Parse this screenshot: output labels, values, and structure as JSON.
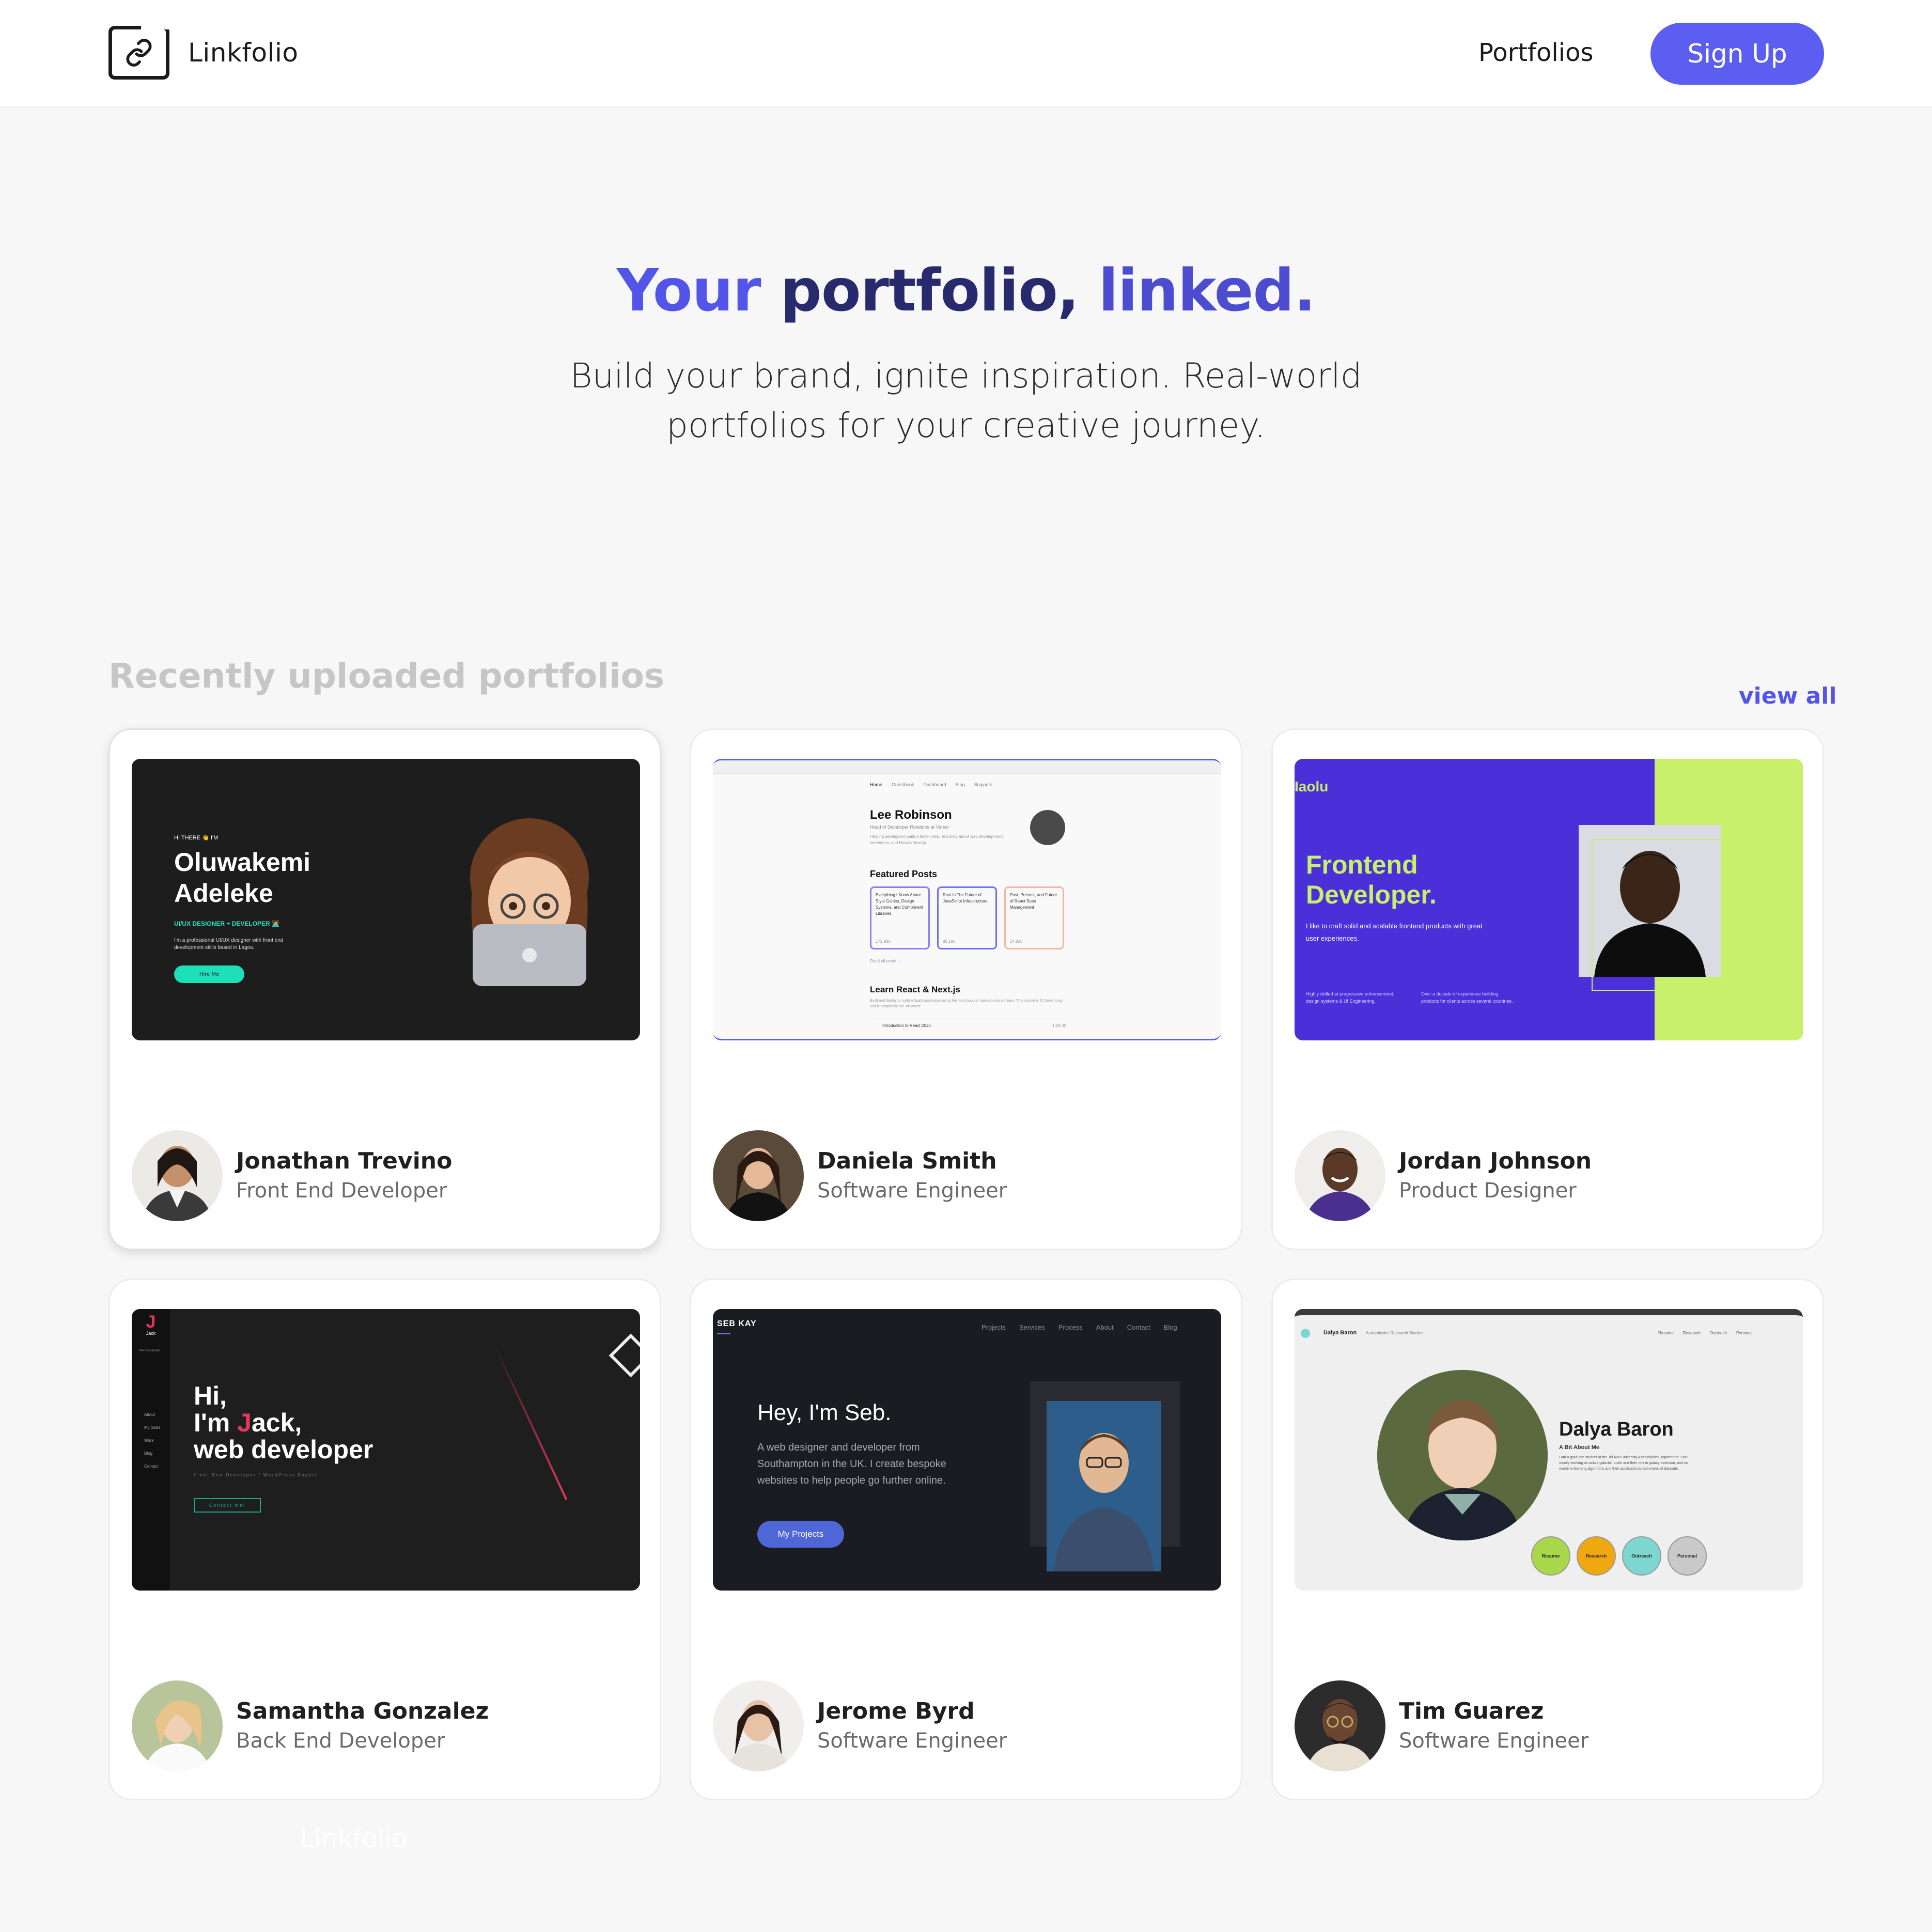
{
  "header": {
    "brand": "Linkfolio",
    "nav_portfolios": "Portfolios",
    "signup": "Sign Up"
  },
  "hero": {
    "title_w1": "Your",
    "title_w2": "portfolio,",
    "title_w3": "linked.",
    "subtitle": "Build your brand, ignite inspiration. Real-world portfolios for your creative journey."
  },
  "section": {
    "title": "Recently uploaded portfolios",
    "view_all": "view all"
  },
  "cards": [
    {
      "name": "Jonathan Trevino",
      "role": "Front End Developer",
      "thumb": {
        "greeting": "HI THERE 👋 I'M",
        "first": "Oluwakemi",
        "last": "Adeleke",
        "tag": "UI/UX DESIGNER + DEVELOPER 🧑‍💻",
        "desc": "I'm a professional UI/UX designer with front end development skills based in Lagos.",
        "cta": "Hire Me"
      }
    },
    {
      "name": "Daniela Smith",
      "role": "Software Engineer",
      "thumb": {
        "nav": [
          "Home",
          "Guestbook",
          "Dashboard",
          "Blog",
          "Snippets"
        ],
        "name": "Lee Robinson",
        "subtitle": "Head of Developer Relations at Vercel",
        "desc": "Helping developers build a faster web. Teaching about web development, serverless, and React / Next.js.",
        "featured": "Featured Posts",
        "posts": [
          "Everything I Know About Style Guides, Design Systems, and Component Libraries",
          "Rust Is The Future of JavaScript Infrastructure",
          "Past, Present, and Future of React State Management"
        ],
        "views": [
          "172,985",
          "86,186",
          "24,818"
        ],
        "read_all": "Read all posts →",
        "course": "Learn React & Next.js",
        "course_desc": "Build and deploy a modern SaaS application using the most popular open-source software. This course is 12 hours long and is completely live streamed.",
        "lesson": "Introduction to React 2025",
        "lesson_time": "1:04:30"
      }
    },
    {
      "name": "Jordan Johnson",
      "role": "Product Designer",
      "thumb": {
        "logo": "Iaolu",
        "headline1": "Frontend",
        "headline2": "Developer.",
        "desc": "I like to craft solid and scalable frontend products with great user experiences.",
        "col1": "Highly skilled at progressive enhancement, design systems & UI Engineering.",
        "col2": "Over a decade of experience building products for clients across several countries."
      }
    },
    {
      "name": "Samantha Gonzalez",
      "role": "Back End Developer",
      "thumb": {
        "logo": "Jack",
        "logo_sub": "Web Developer",
        "menu": [
          "About",
          "My Skills",
          "Work",
          "Blog",
          "Contact"
        ],
        "line1": "Hi,",
        "line2_pre": "I'm ",
        "line2_j": "J",
        "line2_post": "ack,",
        "line3": "web developer",
        "sub": "Front End Developer / WordPress Expert",
        "cta": "Contact me!"
      }
    },
    {
      "name": "Jerome Byrd",
      "role": "Software Engineer",
      "thumb": {
        "logo": "SEB KAY",
        "nav": [
          "Projects",
          "Services",
          "Process",
          "About",
          "Contact",
          "Blog"
        ],
        "headline": "Hey, I'm Seb.",
        "desc": "A web designer and developer from Southampton in the UK. I create bespoke websites to help people go further online.",
        "cta": "My Projects"
      }
    },
    {
      "name": "Tim Guarez",
      "role": "Software Engineer",
      "thumb": {
        "brand": "Dalya Baron",
        "brand_sub": "Astrophysics Research Student",
        "nav": [
          "Resume",
          "Research",
          "Outreach",
          "Personal"
        ],
        "name": "Dalya Baron",
        "about": "A Bit About Me",
        "desc": "I am a graduate student at the Tel Aviv University Astrophysics Department. I am mostly working on active galactic nuclei and their role in galaxy evolution, and on machine learning algorithms and their application to astronomical datasets.",
        "pills": [
          "Resume",
          "Research",
          "Outreach",
          "Personal"
        ]
      }
    }
  ],
  "footer": {
    "ghost_brand": "Linkfolio"
  },
  "colors": {
    "accent": "#5b5ef0",
    "title_dark": "#282a6e",
    "card_border": "#ececec",
    "page_bg": "#f7f7f7"
  },
  "icons": [
    "link-icon"
  ]
}
